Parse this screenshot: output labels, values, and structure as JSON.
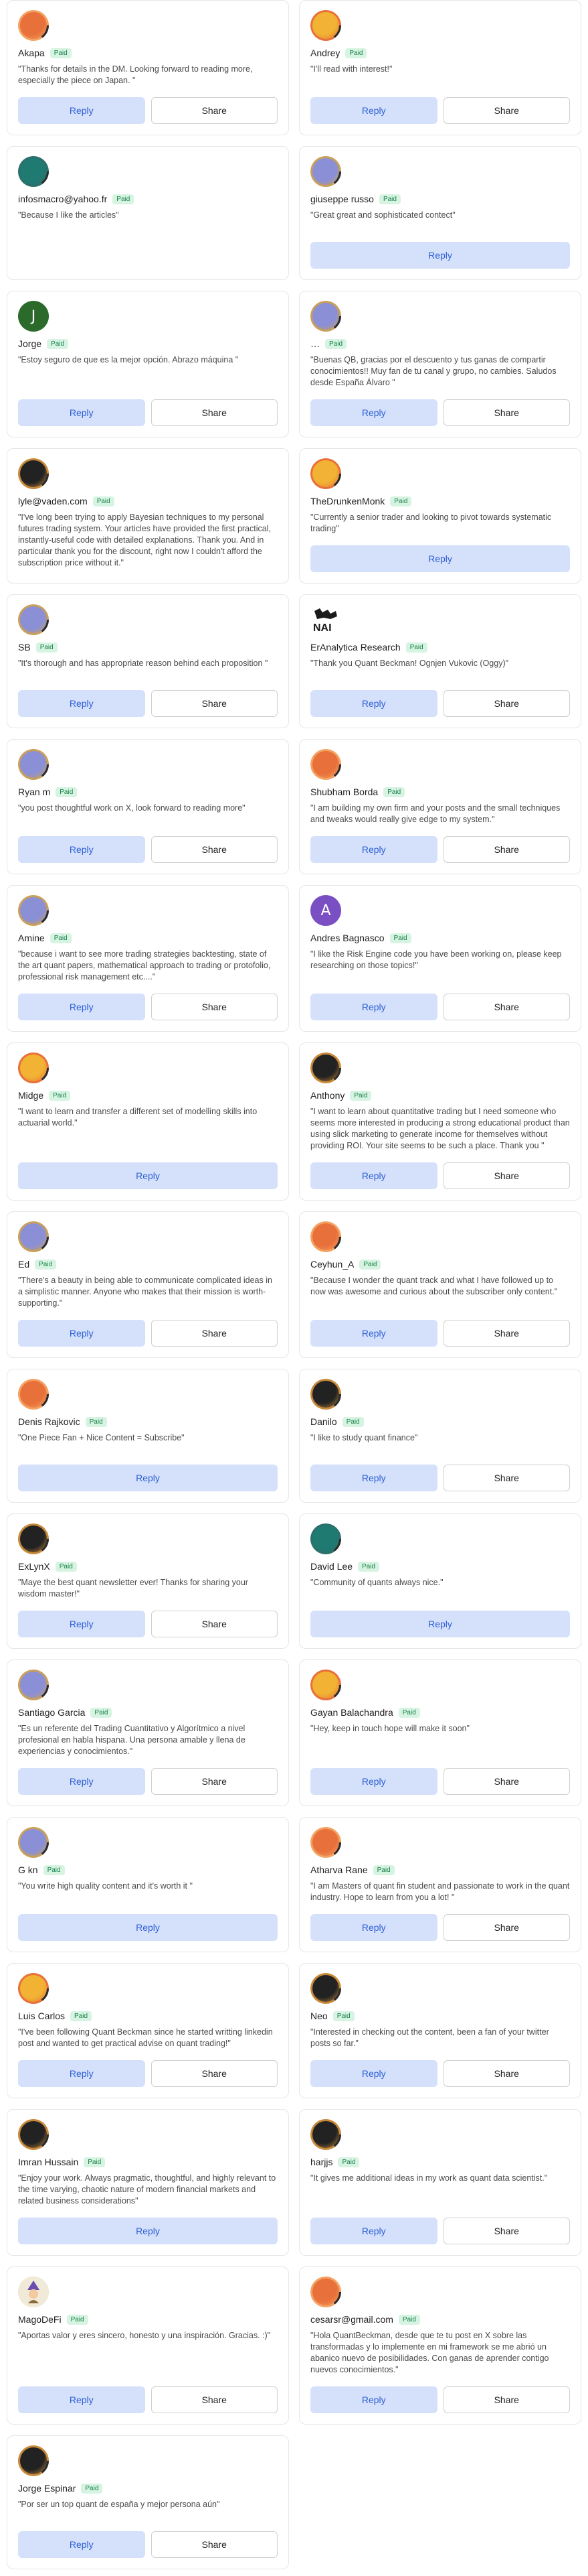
{
  "labels": {
    "badge": "Paid",
    "reply": "Reply",
    "share": "Share"
  },
  "avatar_palette": {
    "orange": [
      "#e8703a",
      "#f4a261"
    ],
    "teal": [
      "#1f7a72",
      "#2d6f6a"
    ],
    "green_letter": "#2b6a2b",
    "lavender": [
      "#8a8fd6",
      "#c9a05a"
    ],
    "dark": [
      "#222222",
      "#c88a3a"
    ],
    "gold": [
      "#f2b233",
      "#e8703a"
    ],
    "purple_letter": "#7b4fc4"
  },
  "cards": [
    {
      "name": "Akapa",
      "avatar": "orange",
      "reason": "\"Thanks for details in the DM. Looking forward to reading more, especially the piece on Japan. \"",
      "share": true
    },
    {
      "name": "Andrey",
      "avatar": "gold",
      "reason": "\"I'll read with interest!\"",
      "share": true
    },
    {
      "name": "infosmacro@yahoo.fr",
      "avatar": "teal",
      "reason": "\"Because I like the articles\"",
      "share": false,
      "noreply": true
    },
    {
      "name": "giuseppe russo",
      "avatar": "lavender",
      "reason": "\"Great great and sophisticated contect\"",
      "share": false
    },
    {
      "name": "Jorge",
      "avatar": "letter-green",
      "letter": "J",
      "reason": "\"Estoy seguro de que es la mejor opción. Abrazo máquina \"",
      "share": true
    },
    {
      "name": "…",
      "avatar": "lavender",
      "reason": "\"Buenas QB, gracias por el descuento y tus ganas de compartir conocimientos!! Muy fan de tu canal y grupo, no cambies. Saludos desde España Álvaro \"",
      "share": true
    },
    {
      "name": "lyle@vaden.com",
      "avatar": "dark",
      "reason": "\"I've long been trying to apply Bayesian techniques to my personal futures trading system. Your articles have provided the first practical, instantly-useful code with detailed explanations. Thank you. And in particular thank you for the discount, right now I couldn't afford the subscription price without it.\"",
      "share": false,
      "noreply": true
    },
    {
      "name": "TheDrunkenMonk",
      "avatar": "gold",
      "reason": "\"Currently a senior trader and looking to pivot towards systematic trading\"",
      "share": false
    },
    {
      "name": "SB",
      "avatar": "lavender",
      "reason": "\"It's thorough and has appropriate reason behind each proposition \"",
      "share": true
    },
    {
      "name": "ErAnalytica Research",
      "avatar": "logo",
      "reason": "\"Thank you Quant Beckman! Ognjen Vukovic (Oggy)\"",
      "share": true
    },
    {
      "name": "Ryan m",
      "avatar": "lavender",
      "reason": "\"you post thoughtful work on X, look forward to reading more\"",
      "share": true
    },
    {
      "name": "Shubham Borda",
      "avatar": "orange",
      "reason": "\"I am building my own firm and your posts and the small techniques and tweaks would really give edge to my system.\"",
      "share": true
    },
    {
      "name": "Amine",
      "avatar": "lavender",
      "reason": "\"because i want to see more trading strategies backtesting, state of the art quant papers, mathematical approach to trading or protofolio, professional risk management etc....\"",
      "share": true
    },
    {
      "name": "Andres Bagnasco",
      "avatar": "letter-purple",
      "letter": "A",
      "reason": "\"I like the Risk Engine code you have been working on, please keep researching on those topics!\"",
      "share": true
    },
    {
      "name": "Midge",
      "avatar": "gold",
      "reason": "\"I want to learn and transfer a different set of modelling skills into actuarial world.\"",
      "share": false
    },
    {
      "name": "Anthony",
      "avatar": "dark",
      "reason": "\"I want to learn about quantitative trading but I need someone who seems more interested in producing a strong educational product than using slick marketing to generate income for themselves without providing ROI. Your site seems to be such a place. Thank you \"",
      "share": true
    },
    {
      "name": "Ed",
      "avatar": "lavender",
      "reason": "\"There's a beauty in being able to communicate complicated ideas in a simplistic manner. Anyone who makes that their mission is worth-supporting.\"",
      "share": true
    },
    {
      "name": "Ceyhun_A",
      "avatar": "orange",
      "reason": "\"Because I wonder the quant track and what I have followed up to now was awesome and curious about the subscriber only content.\"",
      "share": true
    },
    {
      "name": "Denis Rajkovic",
      "avatar": "orange",
      "reason": "\"One Piece Fan + Nice Content = Subscribe\"",
      "share": false
    },
    {
      "name": "Danilo",
      "avatar": "dark",
      "reason": "\"I like to study quant finance\"",
      "share": true
    },
    {
      "name": "ExLynX",
      "avatar": "dark",
      "reason": "\"Maye the best quant newsletter ever! Thanks for sharing your wisdom master!\"",
      "share": true
    },
    {
      "name": "David Lee",
      "avatar": "teal",
      "reason": "\"Community of quants always nice.\"",
      "share": false
    },
    {
      "name": "Santiago Garcia",
      "avatar": "lavender",
      "reason": "\"Es un referente del Trading Cuantitativo y Algorítmico a nivel profesional en habla hispana. Una persona amable y llena de experiencias y conocimientos.\"",
      "share": true
    },
    {
      "name": "Gayan Balachandra",
      "avatar": "gold",
      "reason": "\"Hey, keep in touch hope will make it soon\"",
      "share": true
    },
    {
      "name": "G kn",
      "avatar": "lavender",
      "reason": "\"You write high quality content and it's worth it \"",
      "share": false
    },
    {
      "name": "Atharva Rane",
      "avatar": "orange",
      "reason": "\"I am Masters of quant fin student and passionate to work in the quant industry. Hope to learn from you a lot! \"",
      "share": true
    },
    {
      "name": "Luis Carlos",
      "avatar": "gold",
      "reason": "\"I've been following Quant Beckman since he started writting linkedin post and wanted to get practical advise on quant trading!\"",
      "share": true
    },
    {
      "name": "Neo",
      "avatar": "dark",
      "reason": "\"Interested in checking out the content, been a fan of your twitter posts so far.\"",
      "share": true
    },
    {
      "name": "Imran Hussain",
      "avatar": "dark",
      "reason": "\"Enjoy your work. Always pragmatic, thoughtful, and highly relevant to the time varying, chaotic nature of modern financial markets and related business considerations\"",
      "share": false
    },
    {
      "name": "harjjs",
      "avatar": "dark",
      "reason": "\"It gives me additional ideas in my work as quant data scientist.\"",
      "share": true
    },
    {
      "name": "MagoDeFi",
      "avatar": "mago",
      "reason": "\"Aportas valor y eres sincero, honesto y una inspiración. Gracias. :)\"",
      "share": true
    },
    {
      "name": "cesarsr@gmail.com",
      "avatar": "orange",
      "reason": "\"Hola QuantBeckman, desde que te tu post en X sobre las transformadas y lo implemente en mi framework se me abrió un abanico nuevo de posibilidades. Con ganas de aprender contigo nuevos conocimientos.\"",
      "share": true
    },
    {
      "name": "Jorge Espinar",
      "avatar": "dark",
      "reason": "\"Por ser un top quant de españa y mejor persona aún\"",
      "share": true
    }
  ]
}
